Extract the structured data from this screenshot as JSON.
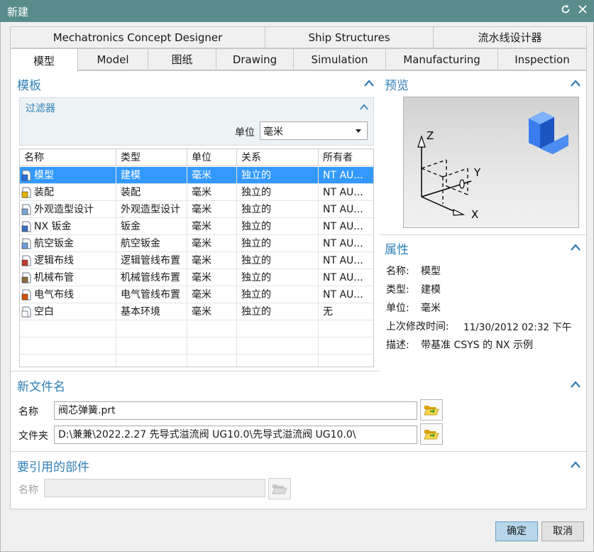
{
  "window": {
    "title": "新建",
    "reset_icon": "reset-icon",
    "close_icon": "close-icon"
  },
  "tabs": {
    "row1": [
      "Mechatronics Concept Designer",
      "Ship Structures",
      "流水线设计器"
    ],
    "row2": [
      "模型",
      "Model",
      "图纸",
      "Drawing",
      "Simulation",
      "Manufacturing",
      "Inspection"
    ],
    "active": "模型"
  },
  "template": {
    "title": "模板",
    "filter": {
      "title": "过滤器",
      "unit_label": "单位",
      "unit_value": "毫米"
    },
    "columns": [
      "名称",
      "类型",
      "单位",
      "关系",
      "所有者"
    ],
    "rows": [
      {
        "name": "模型",
        "type": "建模",
        "unit": "毫米",
        "relation": "独立的",
        "owner": "NT AU...",
        "icon": "model-icon",
        "selected": true
      },
      {
        "name": "装配",
        "type": "装配",
        "unit": "毫米",
        "relation": "独立的",
        "owner": "NT AU...",
        "icon": "assembly-icon"
      },
      {
        "name": "外观造型设计",
        "type": "外观造型设计",
        "unit": "毫米",
        "relation": "独立的",
        "owner": "NT AU...",
        "icon": "shape-design-icon"
      },
      {
        "name": "NX 钣金",
        "type": "钣金",
        "unit": "毫米",
        "relation": "独立的",
        "owner": "NT AU...",
        "icon": "sheet-metal-icon"
      },
      {
        "name": "航空钣金",
        "type": "航空钣金",
        "unit": "毫米",
        "relation": "独立的",
        "owner": "NT AU...",
        "icon": "aero-sheet-metal-icon"
      },
      {
        "name": "逻辑布线",
        "type": "逻辑管线布置",
        "unit": "毫米",
        "relation": "独立的",
        "owner": "NT AU...",
        "icon": "logic-routing-icon"
      },
      {
        "name": "机械布管",
        "type": "机械管线布置",
        "unit": "毫米",
        "relation": "独立的",
        "owner": "NT AU...",
        "icon": "mech-routing-icon"
      },
      {
        "name": "电气布线",
        "type": "电气管线布置",
        "unit": "毫米",
        "relation": "独立的",
        "owner": "NT AU...",
        "icon": "elec-routing-icon"
      },
      {
        "name": "空白",
        "type": "基本环境",
        "unit": "毫米",
        "relation": "独立的",
        "owner": "无",
        "icon": "blank-icon"
      }
    ]
  },
  "preview": {
    "title": "预览",
    "axis_x": "X",
    "axis_y": "Y",
    "axis_z": "Z"
  },
  "properties": {
    "title": "属性",
    "name_label": "名称:",
    "name_value": "模型",
    "type_label": "类型:",
    "type_value": "建模",
    "unit_label": "单位:",
    "unit_value": "毫米",
    "modified_label": "上次修改时间:",
    "modified_value": "11/30/2012 02:32 下午",
    "desc_label": "描述:",
    "desc_value": "带基准 CSYS 的 NX 示例"
  },
  "new_file": {
    "title": "新文件名",
    "name_label": "名称",
    "name_value": "阀芯弹簧.prt",
    "folder_label": "文件夹",
    "folder_value": "D:\\兼兼\\2022.2.27  先导式溢流阀 UG10.0\\先导式溢流阀  UG10.0\\"
  },
  "reference": {
    "title": "要引用的部件",
    "name_label": "名称",
    "name_value": ""
  },
  "buttons": {
    "ok": "确定",
    "cancel": "取消"
  },
  "colors": {
    "titlebar": "#5a8c8c",
    "accent": "#2f7fb5",
    "selection": "#3399ff"
  }
}
